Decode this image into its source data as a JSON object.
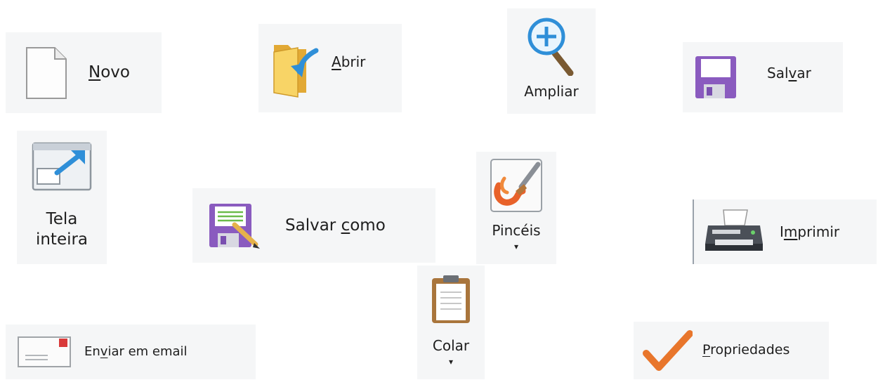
{
  "buttons": {
    "novo": {
      "pre": "",
      "ul": "N",
      "post": "ovo",
      "icon": "blank-document-icon"
    },
    "abrir": {
      "pre": "",
      "ul": "A",
      "post": "brir",
      "icon": "open-folder-icon"
    },
    "ampliar": {
      "label": "Ampliar",
      "icon": "zoom-in-icon"
    },
    "salvar": {
      "pre": "Sal",
      "ul": "v",
      "post": "ar",
      "icon": "floppy-disk-icon"
    },
    "tela_inteira": {
      "line1": "Tela",
      "line2": "inteira",
      "icon": "fullscreen-icon"
    },
    "salvar_como": {
      "pre": "Salvar ",
      "ul": "c",
      "post": "omo",
      "icon": "save-as-icon"
    },
    "pinceis": {
      "label": "Pincéis",
      "caret": "▾",
      "icon": "brush-icon"
    },
    "imprimir": {
      "pre": "I",
      "ul": "m",
      "post": "primir",
      "icon": "printer-icon"
    },
    "colar": {
      "label": "Colar",
      "caret": "▾",
      "icon": "clipboard-icon"
    },
    "enviar_email": {
      "pre": "En",
      "ul": "v",
      "post": "iar em email",
      "icon": "email-envelope-icon"
    },
    "propriedades": {
      "pre": "",
      "ul": "P",
      "post": "ropriedades",
      "icon": "checkmark-icon"
    }
  },
  "colors": {
    "tile_bg": "#f5f6f7",
    "floppy": "#8a5bbf",
    "folder": "#f3c24a",
    "accent_blue": "#2f8fd8",
    "check": "#e8762c"
  }
}
